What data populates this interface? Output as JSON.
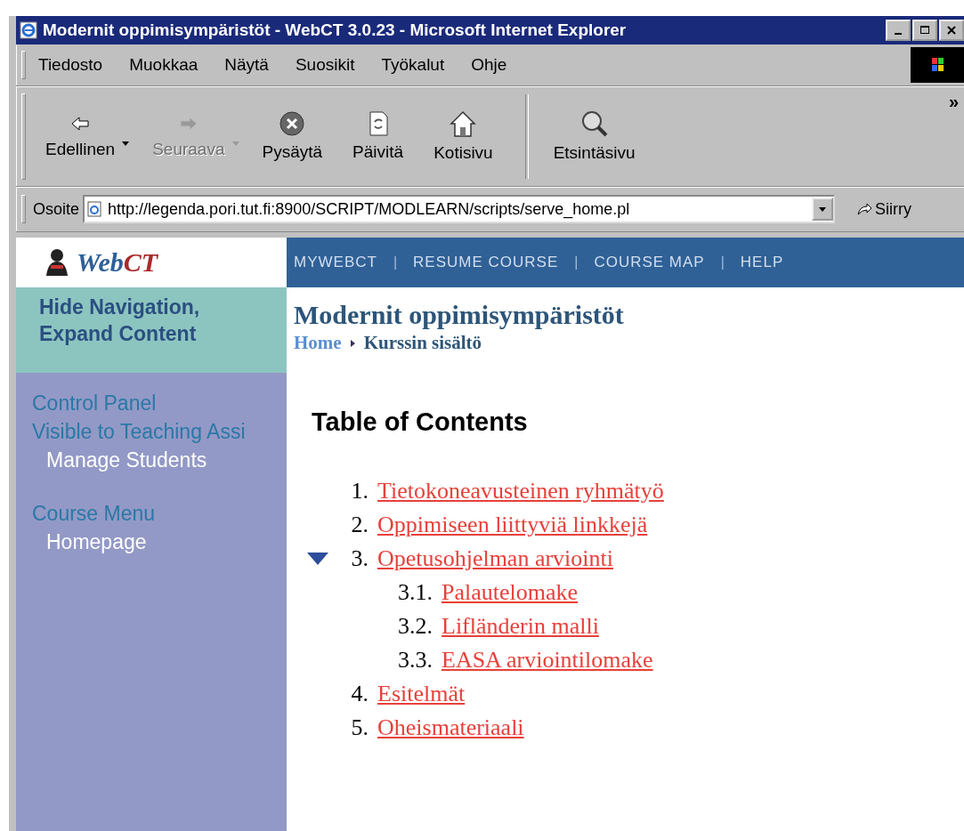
{
  "window": {
    "title": "Modernit oppimisympäristöt - WebCT 3.0.23 - Microsoft Internet Explorer"
  },
  "menu": [
    "Tiedosto",
    "Muokkaa",
    "Näytä",
    "Suosikit",
    "Työkalut",
    "Ohje"
  ],
  "toolbar": [
    {
      "label": "Edellinen",
      "kind": "back",
      "dropdown": true,
      "disabled": false
    },
    {
      "label": "Seuraava",
      "kind": "forward",
      "dropdown": true,
      "disabled": true
    },
    {
      "label": "Pysäytä",
      "kind": "stop",
      "dropdown": false,
      "disabled": false
    },
    {
      "label": "Päivitä",
      "kind": "refresh",
      "dropdown": false,
      "disabled": false
    },
    {
      "label": "Kotisivu",
      "kind": "home",
      "dropdown": false,
      "disabled": false
    },
    {
      "label": "Etsintäsivu",
      "kind": "search",
      "dropdown": false,
      "disabled": false
    }
  ],
  "toolbar_more": "»",
  "address": {
    "label": "Osoite",
    "value": "http://legenda.pori.tut.fi:8900/SCRIPT/MODLEARN/scripts/serve_home.pl",
    "go": "Siirry"
  },
  "page": {
    "logo": {
      "web": "Web",
      "ct": "CT"
    },
    "topnav": [
      {
        "kind": "link",
        "label": "MYWEBCT"
      },
      {
        "kind": "separator",
        "label": "|"
      },
      {
        "kind": "link",
        "label": "RESUME COURSE"
      },
      {
        "kind": "separator",
        "label": "|"
      },
      {
        "kind": "link",
        "label": "COURSE MAP"
      },
      {
        "kind": "separator",
        "label": "|"
      },
      {
        "kind": "link",
        "label": "HELP"
      }
    ],
    "hide_nav": "Hide Navigation, Expand Content",
    "sidebar": [
      {
        "items": [
          {
            "label": "Control Panel"
          },
          {
            "label": "Visible to Teaching Assi",
            "children": [
              {
                "label": "Manage Students"
              }
            ]
          }
        ]
      },
      {
        "items": [
          {
            "label": "Course Menu",
            "children": [
              {
                "label": "Homepage"
              }
            ]
          }
        ]
      }
    ],
    "course_title": "Modernit oppimisympäristöt",
    "breadcrumb": [
      {
        "label": "Home",
        "kind": "link"
      },
      {
        "label": "Kurssin sisältö",
        "kind": "current"
      }
    ],
    "toc_heading": "Table of Contents",
    "toc": [
      {
        "number": "1.",
        "title": "Tietokoneavusteinen ryhmätyö",
        "expanded": false
      },
      {
        "number": "2.",
        "title": "Oppimiseen liittyviä linkkejä",
        "expanded": false
      },
      {
        "number": "3.",
        "title": "Opetusohjelman arviointi",
        "expanded": true,
        "children": [
          {
            "number": "3.1.",
            "title": "Palautelomake"
          },
          {
            "number": "3.2.",
            "title": "Lifländerin malli"
          },
          {
            "number": "3.3.",
            "title": "EASA arviointilomake"
          }
        ]
      },
      {
        "number": "4.",
        "title": "Esitelmät",
        "expanded": false
      },
      {
        "number": "5.",
        "title": "Oheismateriaali",
        "expanded": false
      }
    ]
  }
}
